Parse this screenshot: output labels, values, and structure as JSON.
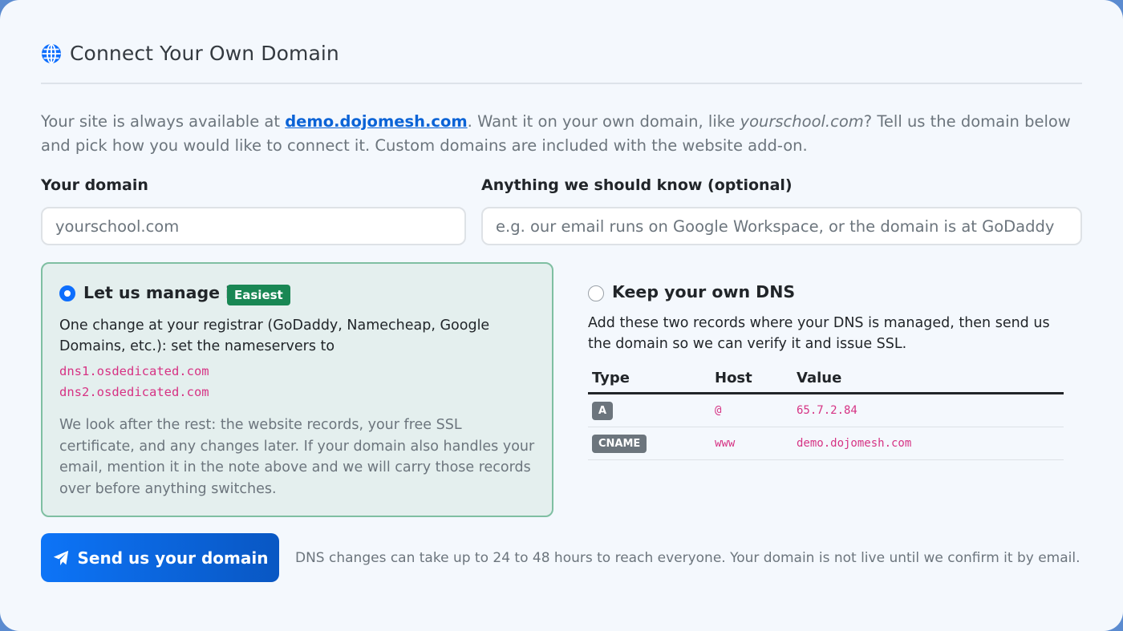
{
  "header": {
    "title": "Connect Your Own Domain",
    "icon": "globe-icon"
  },
  "intro": {
    "part1": "Your site is always available at ",
    "link": "demo.dojomesh.com",
    "part2": ". Want it on your own domain, like ",
    "example": "yourschool.com",
    "part3": "? Tell us the domain below and pick how you would like to connect it. Custom domains are included with the website add-on."
  },
  "form": {
    "domain_label": "Your domain",
    "domain_placeholder": "yourschool.com",
    "domain_value": "",
    "note_label": "Anything we should know (optional)",
    "note_placeholder": "e.g. our email runs on Google Workspace, or the domain is at GoDaddy",
    "note_value": ""
  },
  "option_managed": {
    "title": "Let us manage it",
    "badge": "Easiest",
    "selected": true,
    "description": "One change at your registrar (GoDaddy, Namecheap, Google Domains, etc.): set the nameservers to",
    "nameservers": [
      "dns1.osdedicated.com",
      "dns2.osdedicated.com"
    ],
    "details": "We look after the rest: the website records, your free SSL certificate, and any changes later. If your domain also handles your email, mention it in the note above and we will carry those records over before anything switches."
  },
  "option_own_dns": {
    "title": "Keep your own DNS",
    "selected": false,
    "description": "Add these two records where your DNS is managed, then send us the domain so we can verify it and issue SSL.",
    "table": {
      "headers": [
        "Type",
        "Host",
        "Value"
      ],
      "rows": [
        {
          "type": "A",
          "host": "@",
          "value": "65.7.2.84"
        },
        {
          "type": "CNAME",
          "host": "www",
          "value": "demo.dojomesh.com"
        }
      ]
    }
  },
  "footer": {
    "button_label": "Send us your domain",
    "button_icon": "paper-plane-icon",
    "note": "DNS changes can take up to 24 to 48 hours to reach everyone. Your domain is not live until we confirm it by email."
  },
  "colors": {
    "accent": "#0d6efd",
    "success_badge": "#198754",
    "managed_bg": "#e4efee",
    "managed_border": "#7fbfa2",
    "code": "#d63384"
  }
}
